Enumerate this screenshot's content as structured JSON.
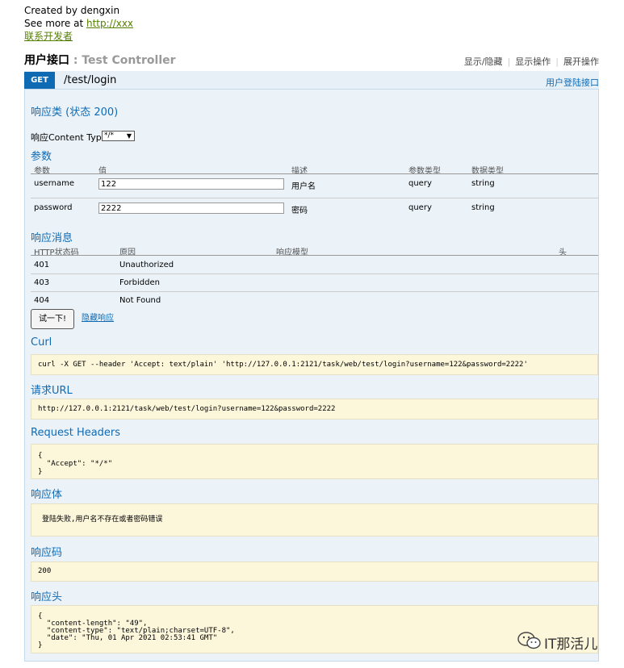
{
  "info": {
    "created_by": "Created by dengxin",
    "see_more_prefix": "See more at ",
    "see_more_link": "http://xxx",
    "contact": "联系开发者"
  },
  "resource": {
    "name": "用户接口",
    "separator": " : ",
    "controller": "Test Controller",
    "ops": [
      "显示/隐藏",
      "显示操作",
      "展开操作"
    ]
  },
  "operation": {
    "method": "GET",
    "path": "/test/login",
    "summary": "用户登陆接口",
    "response_class": "响应类 (状态 200)",
    "content_type_label": "响应Content Type",
    "content_type_value": "*/*"
  },
  "params": {
    "title": "参数",
    "headers": [
      "参数",
      "值",
      "描述",
      "参数类型",
      "数据类型"
    ],
    "rows": [
      {
        "name": "username",
        "value": "122",
        "desc": "用户名",
        "ptype": "query",
        "dtype": "string"
      },
      {
        "name": "password",
        "value": "2222",
        "desc": "密码",
        "ptype": "query",
        "dtype": "string"
      }
    ]
  },
  "responses": {
    "title": "响应消息",
    "headers": [
      "HTTP状态码",
      "原因",
      "响应模型",
      "头"
    ],
    "rows": [
      {
        "code": "401",
        "reason": "Unauthorized"
      },
      {
        "code": "403",
        "reason": "Forbidden"
      },
      {
        "code": "404",
        "reason": "Not Found"
      }
    ]
  },
  "actions": {
    "try_button": "试一下!",
    "hide_response": "隐藏响应"
  },
  "result": {
    "curl_title": "Curl",
    "curl": "curl -X GET --header 'Accept: text/plain' 'http://127.0.0.1:2121/task/web/test/login?username=122&password=2222'",
    "request_url_title": "请求URL",
    "request_url": "http://127.0.0.1:2121/task/web/test/login?username=122&password=2222",
    "request_headers_title": "Request Headers",
    "request_headers": "{\n  \"Accept\": \"*/*\"\n}",
    "body_title": "响应体",
    "body": "登陆失败,用户名不存在或者密码错误",
    "code_title": "响应码",
    "code": "200",
    "headers_title": "响应头",
    "headers": "{\n  \"content-length\": \"49\",\n  \"content-type\": \"text/plain;charset=UTF-8\",\n  \"date\": \"Thu, 01 Apr 2021 02:53:41 GMT\"\n}"
  },
  "watermark": "IT那活儿"
}
